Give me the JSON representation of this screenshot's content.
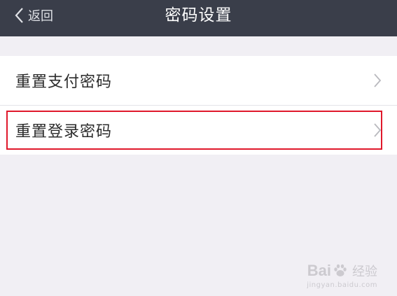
{
  "header": {
    "back_label": "返回",
    "title": "密码设置"
  },
  "list": {
    "items": [
      {
        "label": "重置支付密码"
      },
      {
        "label": "重置登录密码"
      }
    ]
  },
  "watermark": {
    "brand_left": "Bai",
    "brand_right": "经验",
    "url": "jingyan.baidu.com"
  },
  "colors": {
    "header_bg": "#3a3e4a",
    "page_bg": "#f1eff4",
    "highlight": "#e0182b"
  },
  "icons": [
    "back-chevron-icon",
    "chevron-right-icon",
    "paw-icon"
  ]
}
